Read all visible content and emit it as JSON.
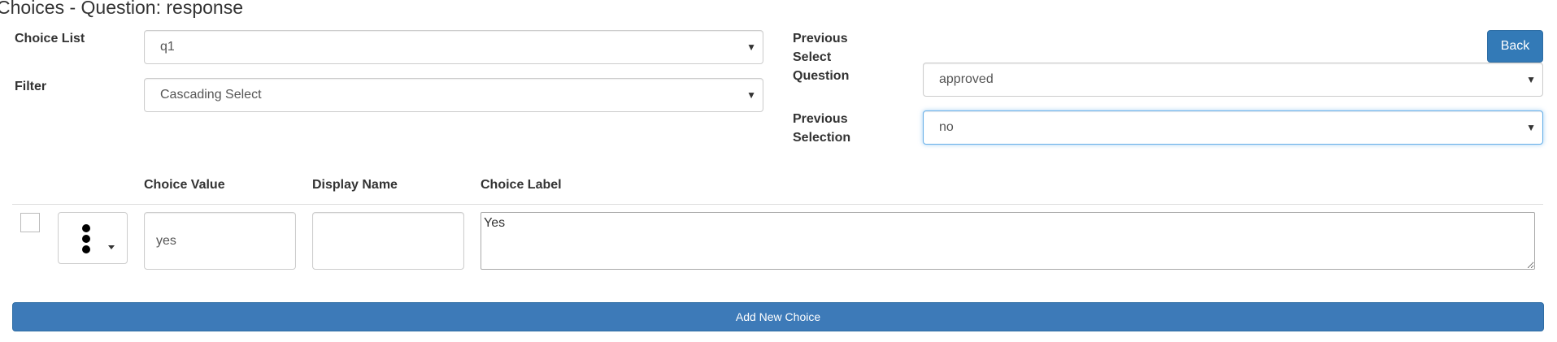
{
  "page": {
    "title": "Choices - Question: response"
  },
  "form": {
    "choice_list_label": "Choice List",
    "choice_list_value": "q1",
    "filter_label": "Filter",
    "filter_value": "Cascading Select",
    "previous_select_question_label": "Previous Select Question",
    "previous_select_question_value": "approved",
    "previous_selection_label": "Previous Selection",
    "previous_selection_value": "no"
  },
  "toolbar": {
    "back_label": "Back"
  },
  "table": {
    "columns": {
      "choice_value": "Choice Value",
      "display_name": "Display Name",
      "choice_label": "Choice Label"
    },
    "rows": [
      {
        "checked": false,
        "choice_value": "yes",
        "display_name": "",
        "choice_label": "Yes"
      }
    ]
  },
  "actions": {
    "add_new_choice_label": "Add New Choice"
  },
  "colors": {
    "primary": "#337ab7",
    "focus_border": "#66afe9"
  },
  "icons": {
    "select_arrow": "chevron-down-icon",
    "row_menu": "kebab-menu-icon"
  }
}
